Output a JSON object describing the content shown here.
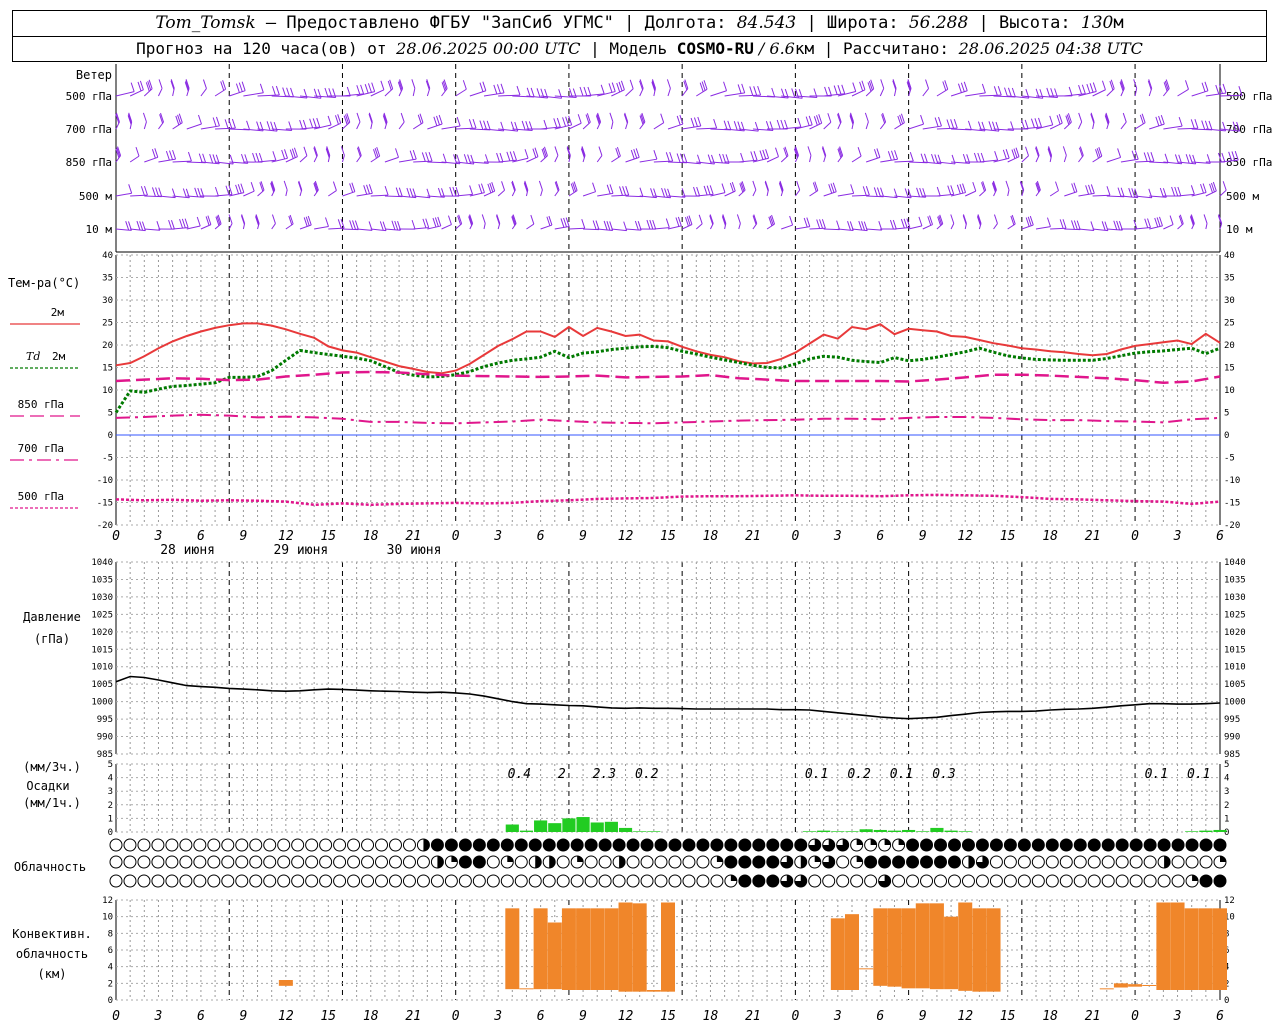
{
  "header": {
    "station": "Tom_Tomsk",
    "provided": " – Предоставлено ФГБУ \"ЗапСиб УГМС\" | Долгота: ",
    "lon": "84.543",
    "lat_label": " | Широта: ",
    "lat": "56.288",
    "alt_label": " | Высота: ",
    "alt": "130",
    "alt_unit": "м",
    "forecast_label": "Прогноз на 120 часа(ов) от ",
    "forecast_time": "28.06.2025 00:00 UTC",
    "model_label": " | Модель ",
    "model": "COSMO-RU",
    "resolution": " / 6.6",
    "res_unit": "км",
    "calc_label": " | Рассчитано: ",
    "calc_time": "28.06.2025 04:38 UTC"
  },
  "colors": {
    "t2m": "#e8393a",
    "td2m": "#007a00",
    "t850": "#e0168c",
    "t700": "#e0168c",
    "t500": "#e0168c",
    "wind": "#8a2be2",
    "precip": "#22cc22",
    "conv": "#f0862a",
    "pressure": "#000000"
  },
  "chart_data": [
    {
      "type": "barbs",
      "ylabel": "Ветер",
      "levels": [
        "500 гПа",
        "700 гПа",
        "850 гПа",
        "500 м",
        "10 м"
      ]
    },
    {
      "type": "line",
      "ylabel": "Тем-ра(°С)",
      "ylim": [
        -20,
        40
      ],
      "yticks": [
        -20,
        -15,
        -10,
        -5,
        0,
        5,
        10,
        15,
        20,
        25,
        30,
        35,
        40
      ],
      "x_hours": [
        0,
        3,
        6,
        9,
        12,
        15,
        18,
        21,
        0,
        3,
        6,
        9,
        12,
        15,
        18,
        21,
        0,
        3,
        6,
        9,
        12,
        15,
        18,
        21,
        0,
        3,
        6
      ],
      "day_labels": [
        "28 июня",
        "29 июня",
        "30 июня"
      ],
      "legend": [
        {
          "label": "2м",
          "style": "solid"
        },
        {
          "label": "Td",
          "label2": "2м",
          "style": "dot"
        },
        {
          "label": "850 гПа",
          "style": "dash"
        },
        {
          "label": "700 гПа",
          "style": "dashdot"
        },
        {
          "label": "500 гПа",
          "style": "dense"
        }
      ],
      "series": [
        {
          "key": "t2m",
          "x": [
            0,
            1,
            2,
            3,
            4,
            5,
            6,
            7,
            8,
            9,
            10,
            11,
            12,
            13,
            14,
            15,
            16,
            17,
            18,
            19,
            20,
            21,
            22,
            23,
            24,
            25,
            26,
            27,
            28,
            29,
            30,
            31,
            32,
            33,
            34,
            35,
            36,
            37,
            38,
            39,
            40,
            41,
            42,
            43,
            44,
            45,
            46,
            47,
            48,
            49,
            50,
            51,
            52,
            53,
            54,
            55,
            56,
            57,
            58,
            59,
            60,
            61,
            62,
            63,
            64,
            65,
            66,
            67,
            68,
            69,
            70,
            71,
            72,
            73,
            74,
            75,
            76,
            77,
            78
          ],
          "values": [
            15.5,
            16,
            17.5,
            19.3,
            20.8,
            22,
            23,
            23.8,
            24.4,
            24.8,
            24.8,
            24.3,
            23.5,
            22.5,
            21.6,
            19.7,
            18.8,
            18.3,
            17.3,
            16.3,
            15.3,
            14.7,
            14,
            13.7,
            14.3,
            15.8,
            17.8,
            19.8,
            21.3,
            23,
            23,
            21.8,
            24,
            22,
            23.8,
            23,
            22,
            22.3,
            21,
            20.8,
            19.6,
            18.6,
            17.8,
            17.3,
            16.4,
            15.9,
            16,
            16.9,
            18.3,
            20.3,
            22.3,
            21.4,
            24,
            23.5,
            24.6,
            22.4,
            23.6,
            23.3,
            23,
            22,
            21.8,
            21.1,
            20.4,
            19.9,
            19.3,
            19,
            18.6,
            18.4,
            18,
            17.7,
            18,
            19,
            19.8,
            20.2,
            20.6,
            21,
            20.2,
            22.5,
            20.5
          ]
        },
        {
          "key": "td2m",
          "x": [
            0,
            1,
            2,
            3,
            4,
            5,
            6,
            7,
            8,
            9,
            10,
            11,
            12,
            13,
            14,
            15,
            16,
            17,
            18,
            19,
            20,
            21,
            22,
            23,
            24,
            25,
            26,
            27,
            28,
            29,
            30,
            31,
            32,
            33,
            34,
            35,
            36,
            37,
            38,
            39,
            40,
            41,
            42,
            43,
            44,
            45,
            46,
            47,
            48,
            49,
            50,
            51,
            52,
            53,
            54,
            55,
            56,
            57,
            58,
            59,
            60,
            61,
            62,
            63,
            64,
            65,
            66,
            67,
            68,
            69,
            70,
            71,
            72,
            73,
            74,
            75,
            76,
            77,
            78
          ],
          "values": [
            5,
            9.8,
            9.5,
            10.2,
            10.8,
            11,
            11.3,
            11.6,
            12.8,
            12.8,
            13,
            14.3,
            16.6,
            18.8,
            18.3,
            17.9,
            17.5,
            17.1,
            16.5,
            15.2,
            13.9,
            13.3,
            12.9,
            13,
            13.4,
            14.1,
            15.2,
            16,
            16.6,
            16.9,
            17.3,
            18.6,
            17.2,
            18.2,
            18.5,
            19,
            19.3,
            19.6,
            19.7,
            19.4,
            18.6,
            18,
            17.3,
            16.7,
            16.1,
            15.5,
            15,
            14.9,
            15.8,
            16.9,
            17.5,
            17.3,
            16.6,
            16.3,
            16.1,
            17.2,
            16.5,
            16.8,
            17.3,
            17.9,
            18.5,
            19.3,
            18.4,
            17.6,
            17.1,
            16.8,
            16.7,
            16.6,
            16.6,
            16.6,
            17,
            17.6,
            18.2,
            18.5,
            18.7,
            19,
            19.3,
            18.1,
            19.3
          ]
        },
        {
          "key": "t850",
          "x": [
            0,
            2,
            4,
            6,
            8,
            10,
            12,
            14,
            16,
            18,
            20,
            22,
            24,
            26,
            28,
            30,
            32,
            34,
            36,
            38,
            40,
            42,
            44,
            46,
            48,
            50,
            52,
            54,
            56,
            58,
            60,
            62,
            64,
            66,
            68,
            70,
            72,
            74,
            76,
            78
          ],
          "values": [
            12,
            12.3,
            12.6,
            12.5,
            12.2,
            12.3,
            13,
            13.4,
            13.9,
            14,
            13.9,
            13.5,
            13.2,
            13.1,
            13,
            12.9,
            13,
            13.2,
            12.8,
            12.9,
            13,
            13.3,
            12.6,
            12.3,
            12,
            12,
            12,
            12,
            11.9,
            12.3,
            12.8,
            13.4,
            13.4,
            13.2,
            12.9,
            12.6,
            12.2,
            11.6,
            11.9,
            13
          ]
        },
        {
          "key": "t700",
          "x": [
            0,
            2,
            4,
            6,
            8,
            10,
            12,
            14,
            16,
            18,
            20,
            22,
            24,
            26,
            28,
            30,
            32,
            34,
            36,
            38,
            40,
            42,
            44,
            46,
            48,
            50,
            52,
            54,
            56,
            58,
            60,
            62,
            64,
            66,
            68,
            70,
            72,
            74,
            76,
            78
          ],
          "values": [
            3.8,
            4,
            4.3,
            4.5,
            4.3,
            3.9,
            4.1,
            3.9,
            3.6,
            2.9,
            2.9,
            2.7,
            2.6,
            2.8,
            3,
            3.4,
            3.1,
            2.8,
            2.7,
            2.6,
            2.8,
            3,
            3.2,
            3.3,
            3.4,
            3.6,
            3.6,
            3.5,
            3.8,
            4,
            4,
            3.8,
            3.5,
            3.3,
            3.3,
            3.1,
            3,
            2.8,
            3.5,
            3.8
          ]
        },
        {
          "key": "t500",
          "x": [
            0,
            2,
            4,
            6,
            8,
            10,
            12,
            14,
            16,
            18,
            20,
            22,
            24,
            26,
            28,
            30,
            32,
            34,
            36,
            38,
            40,
            42,
            44,
            46,
            48,
            50,
            52,
            54,
            56,
            58,
            60,
            62,
            64,
            66,
            68,
            70,
            72,
            74,
            76,
            78
          ],
          "values": [
            -14.3,
            -14.5,
            -14.4,
            -14.6,
            -14.5,
            -14.6,
            -14.8,
            -15.5,
            -15.2,
            -15.5,
            -15.3,
            -15.2,
            -15.1,
            -15.2,
            -15.1,
            -14.7,
            -14.5,
            -14.2,
            -14.1,
            -14,
            -13.7,
            -13.6,
            -13.6,
            -13.5,
            -13.4,
            -13.5,
            -13.5,
            -13.6,
            -13.4,
            -13.3,
            -13.4,
            -13.5,
            -13.8,
            -14.2,
            -14.3,
            -14.5,
            -14.7,
            -14.8,
            -15.3,
            -14.8
          ]
        }
      ]
    },
    {
      "type": "line",
      "ylabel": "Давление",
      "ylabel2": "(гПа)",
      "ylim": [
        985,
        1040
      ],
      "yticks": [
        985,
        990,
        995,
        1000,
        1005,
        1010,
        1015,
        1020,
        1025,
        1030,
        1035,
        1040
      ],
      "series": [
        {
          "key": "pressure",
          "x": [
            0,
            1,
            2,
            3,
            4,
            5,
            6,
            7,
            8,
            9,
            10,
            11,
            12,
            13,
            14,
            15,
            16,
            17,
            18,
            19,
            20,
            21,
            22,
            23,
            24,
            25,
            26,
            27,
            28,
            29,
            30,
            31,
            32,
            33,
            34,
            35,
            36,
            37,
            38,
            39,
            40,
            41,
            42,
            43,
            44,
            45,
            46,
            47,
            48,
            49,
            50,
            51,
            52,
            53,
            54,
            55,
            56,
            57,
            58,
            59,
            60,
            61,
            62,
            63,
            64,
            65,
            66,
            67,
            68,
            69,
            70,
            71,
            72,
            73,
            74,
            75,
            76,
            77,
            78
          ],
          "values": [
            1005.7,
            1007.2,
            1006.9,
            1006.2,
            1005.4,
            1004.6,
            1004.3,
            1004.1,
            1003.8,
            1003.6,
            1003.4,
            1003.1,
            1003,
            1003.1,
            1003.4,
            1003.6,
            1003.5,
            1003.3,
            1003.1,
            1003,
            1002.9,
            1002.7,
            1002.6,
            1002.7,
            1002.5,
            1002.2,
            1001.6,
            1000.8,
            1000,
            999.4,
            999.3,
            999.1,
            998.9,
            998.8,
            998.5,
            998.2,
            998.1,
            998.2,
            998.1,
            998.1,
            998,
            997.9,
            997.9,
            997.9,
            997.9,
            997.9,
            997.9,
            997.7,
            997.7,
            997.6,
            997.2,
            996.8,
            996.4,
            996,
            995.6,
            995.3,
            995.1,
            995.3,
            995.5,
            996,
            996.4,
            996.9,
            997.1,
            997.2,
            997.2,
            997.3,
            997.6,
            997.8,
            997.9,
            998.1,
            998.4,
            998.8,
            999.1,
            999.4,
            999.4,
            999.3,
            999.3,
            999.4,
            999.6
          ]
        }
      ]
    },
    {
      "type": "bar",
      "ylabel": "(мм/3ч.)",
      "ylabel2": "Осадки",
      "ylabel3": "(мм/1ч.)",
      "ylim": [
        0,
        5
      ],
      "yticks": [
        0,
        1,
        2,
        3,
        4,
        5
      ],
      "bars_x": [
        28,
        29,
        30,
        31,
        32,
        33,
        34,
        35,
        36,
        37,
        38,
        39,
        40,
        41,
        42,
        43,
        44,
        45,
        46,
        47,
        48,
        49,
        50,
        51,
        52,
        53,
        54,
        55,
        56,
        57,
        58,
        59,
        60,
        61,
        62,
        63,
        64,
        65,
        66,
        67,
        68,
        69,
        70,
        71,
        72,
        73,
        74,
        75,
        76,
        77,
        78
      ],
      "bars": [
        0.55,
        0.1,
        0.85,
        0.65,
        1,
        1.1,
        0.7,
        0.75,
        0.3,
        0.05,
        0.05,
        0,
        0,
        0,
        0,
        0,
        0,
        0,
        0,
        0,
        0,
        0.05,
        0.1,
        0.05,
        0.05,
        0.2,
        0.15,
        0.1,
        0.15,
        0.05,
        0.3,
        0.1,
        0.05,
        0,
        0,
        0,
        0,
        0,
        0,
        0,
        0,
        0,
        0,
        0,
        0,
        0,
        0,
        0,
        0.05,
        0.1,
        0.15
      ],
      "sums_x": [
        28.5,
        31.5,
        34.5,
        37.5,
        49.5,
        52.5,
        55.5,
        58.5,
        73.5,
        76.5
      ],
      "sums": [
        "0.4",
        "2",
        "2.3",
        "0.2",
        "0.1",
        "0.2",
        "0.1",
        "0.3",
        "0.1",
        "0.1"
      ]
    },
    {
      "type": "cloud",
      "ylabel": "Облачность",
      "rows": [
        "0000000000000000000000244444444444444444444444444433311114444444444444444444444444444",
        "0000000000000000000000021440102201002000000144443213014444444230000000000002000114234444444444422331023444444",
        "00000000000000000000000000000000000000000000144433000003000000000000000000000144444444444444444444233244"
      ]
    },
    {
      "type": "bar",
      "ylabel": "Конвективн.",
      "ylabel2": "облачность",
      "ylabel3": "(км)",
      "ylim": [
        0,
        12
      ],
      "yticks": [
        0,
        2,
        4,
        6,
        8,
        10,
        12
      ],
      "cols_x": [
        12,
        28,
        29,
        30,
        31,
        32,
        33,
        34,
        35,
        36,
        37,
        38,
        39,
        51,
        52,
        53,
        54,
        55,
        56,
        57,
        58,
        59,
        60,
        61,
        62,
        70,
        71,
        72,
        73,
        74,
        75,
        76,
        77,
        78
      ],
      "base": [
        1.7,
        1.3,
        1.3,
        1.3,
        1.3,
        1.2,
        1.2,
        1.2,
        1.2,
        1,
        1,
        1,
        1,
        1.2,
        1.2,
        3.8,
        1.7,
        1.6,
        1.4,
        1.4,
        1.3,
        1.3,
        1.1,
        1,
        1,
        1.4,
        1.5,
        1.6,
        1.7,
        1.2,
        1.2,
        1.2,
        1.2,
        1.2
      ],
      "top": [
        2.4,
        11,
        1.4,
        11,
        9.3,
        11,
        11,
        11,
        11,
        11.7,
        11.6,
        1.2,
        11.7,
        9.8,
        10.3,
        3.8,
        11,
        11,
        11,
        11.6,
        11.6,
        10,
        11.7,
        11,
        11,
        1.4,
        2,
        1.9,
        1.8,
        11.7,
        11.7,
        11,
        11,
        11
      ]
    }
  ]
}
